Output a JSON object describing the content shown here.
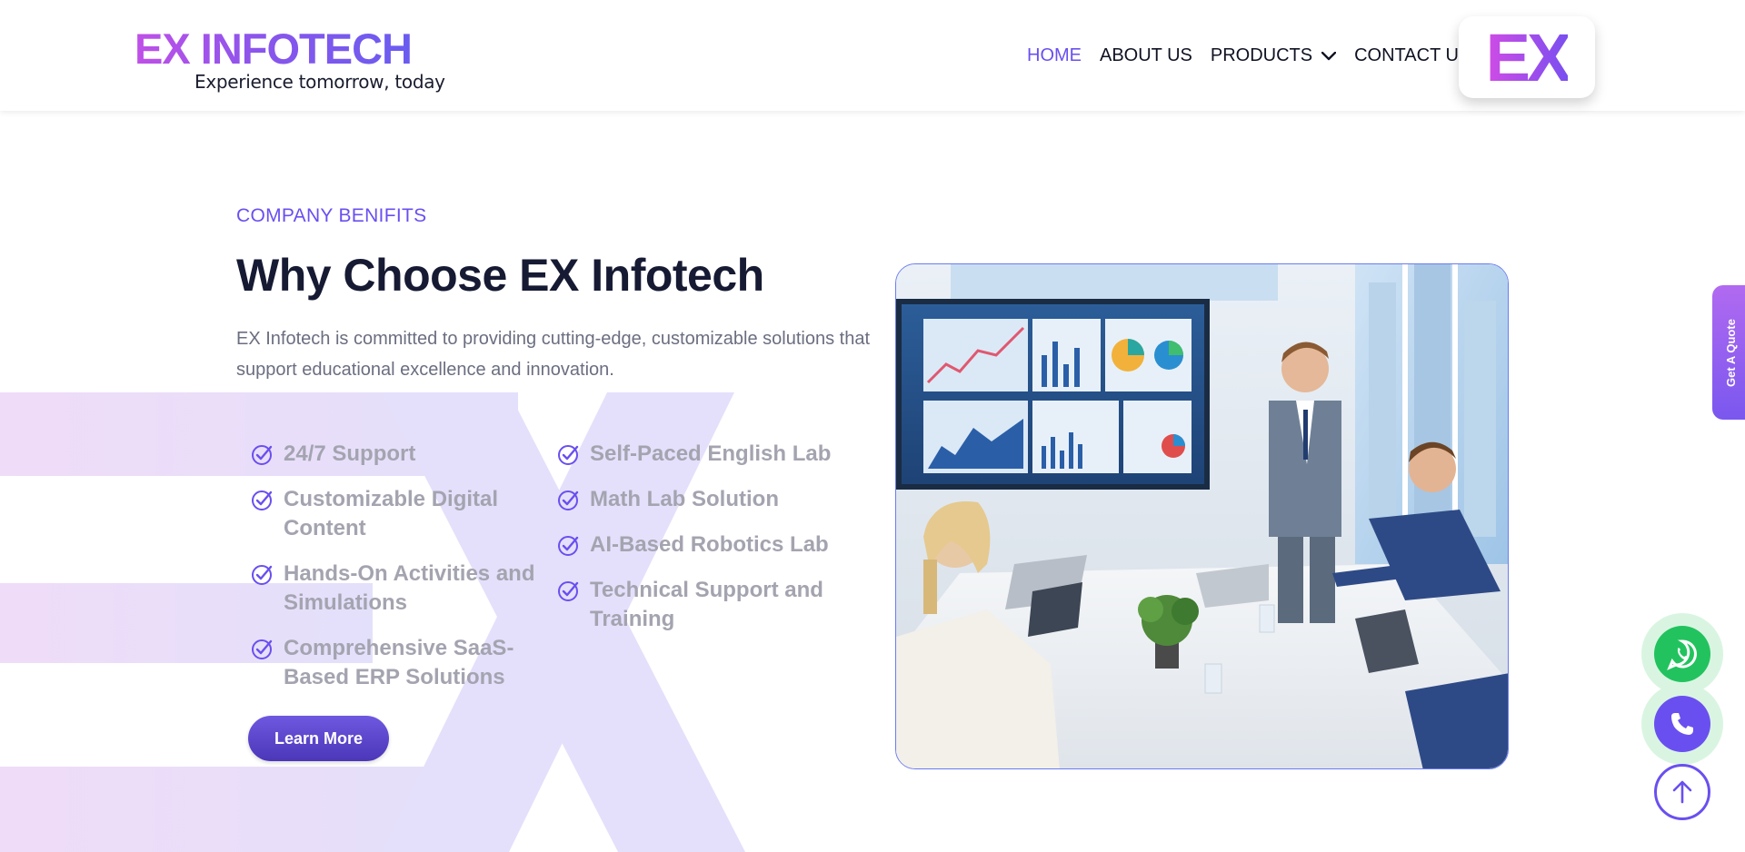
{
  "header": {
    "logo": {
      "wordmark": "EX INFOTECH",
      "tagline": "Experience tomorrow, today"
    },
    "nav": [
      {
        "label": "HOME",
        "active": true
      },
      {
        "label": "ABOUT US",
        "active": false
      },
      {
        "label": "PRODUCTS",
        "active": false,
        "has_dropdown": true
      },
      {
        "label": "CONTACT US",
        "active": false
      }
    ],
    "badge_text": "EX"
  },
  "section": {
    "eyebrow": "COMPANY BENIFITS",
    "title": "Why Choose EX Infotech",
    "description": "EX Infotech is committed to providing cutting-edge, customizable solutions that support educational excellence and innovation.",
    "features_left": [
      "24/7 Support",
      "Customizable Digital Content",
      "Hands-On Activities and Simulations",
      "Comprehensive SaaS-Based ERP Solutions"
    ],
    "features_right": [
      "Self-Paced English Lab",
      "Math Lab Solution",
      "AI-Based Robotics Lab",
      "Technical Support and Training"
    ],
    "cta_label": "Learn More"
  },
  "widgets": {
    "quote_tab": "Get A Quote",
    "whatsapp_icon": "whatsapp-icon",
    "phone_icon": "phone-icon",
    "scroll_top_icon": "arrow-up-icon"
  },
  "colors": {
    "accent": "#6a4ff0",
    "heading": "#161a33",
    "body_text": "#6b6e80",
    "feature_text": "#a4a4b0",
    "whatsapp": "#22c35e"
  }
}
